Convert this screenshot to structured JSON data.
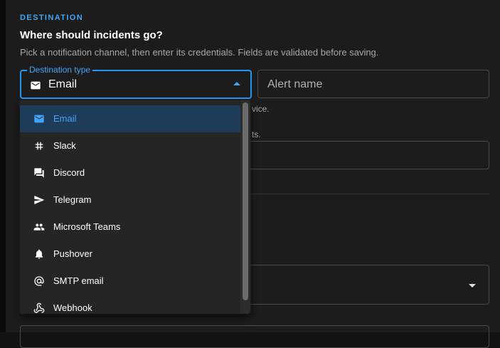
{
  "section": {
    "label": "DESTINATION",
    "title": "Where should incidents go?",
    "subtitle": "Pick a notification channel, then enter its credentials. Fields are validated before saving."
  },
  "destination_type": {
    "legend": "Destination type",
    "value": "Email",
    "value_icon": "email-icon"
  },
  "alert_name": {
    "placeholder": "Alert name",
    "value": ""
  },
  "helpers": {
    "first": "vice.",
    "second": "ts."
  },
  "menu": {
    "items": [
      {
        "label": "Email",
        "icon": "email-icon",
        "selected": true
      },
      {
        "label": "Slack",
        "icon": "hash-icon",
        "selected": false
      },
      {
        "label": "Discord",
        "icon": "chat-bubbles-icon",
        "selected": false
      },
      {
        "label": "Telegram",
        "icon": "send-icon",
        "selected": false
      },
      {
        "label": "Microsoft Teams",
        "icon": "people-icon",
        "selected": false
      },
      {
        "label": "Pushover",
        "icon": "bell-icon",
        "selected": false
      },
      {
        "label": "SMTP email",
        "icon": "at-sign-icon",
        "selected": false
      },
      {
        "label": "Webhook",
        "icon": "webhook-icon",
        "selected": false
      }
    ]
  },
  "colors": {
    "accent": "#42a5f5",
    "selected_bg": "#1e3c5a",
    "panel_bg": "#1c1c1c",
    "menu_bg": "#252525"
  }
}
